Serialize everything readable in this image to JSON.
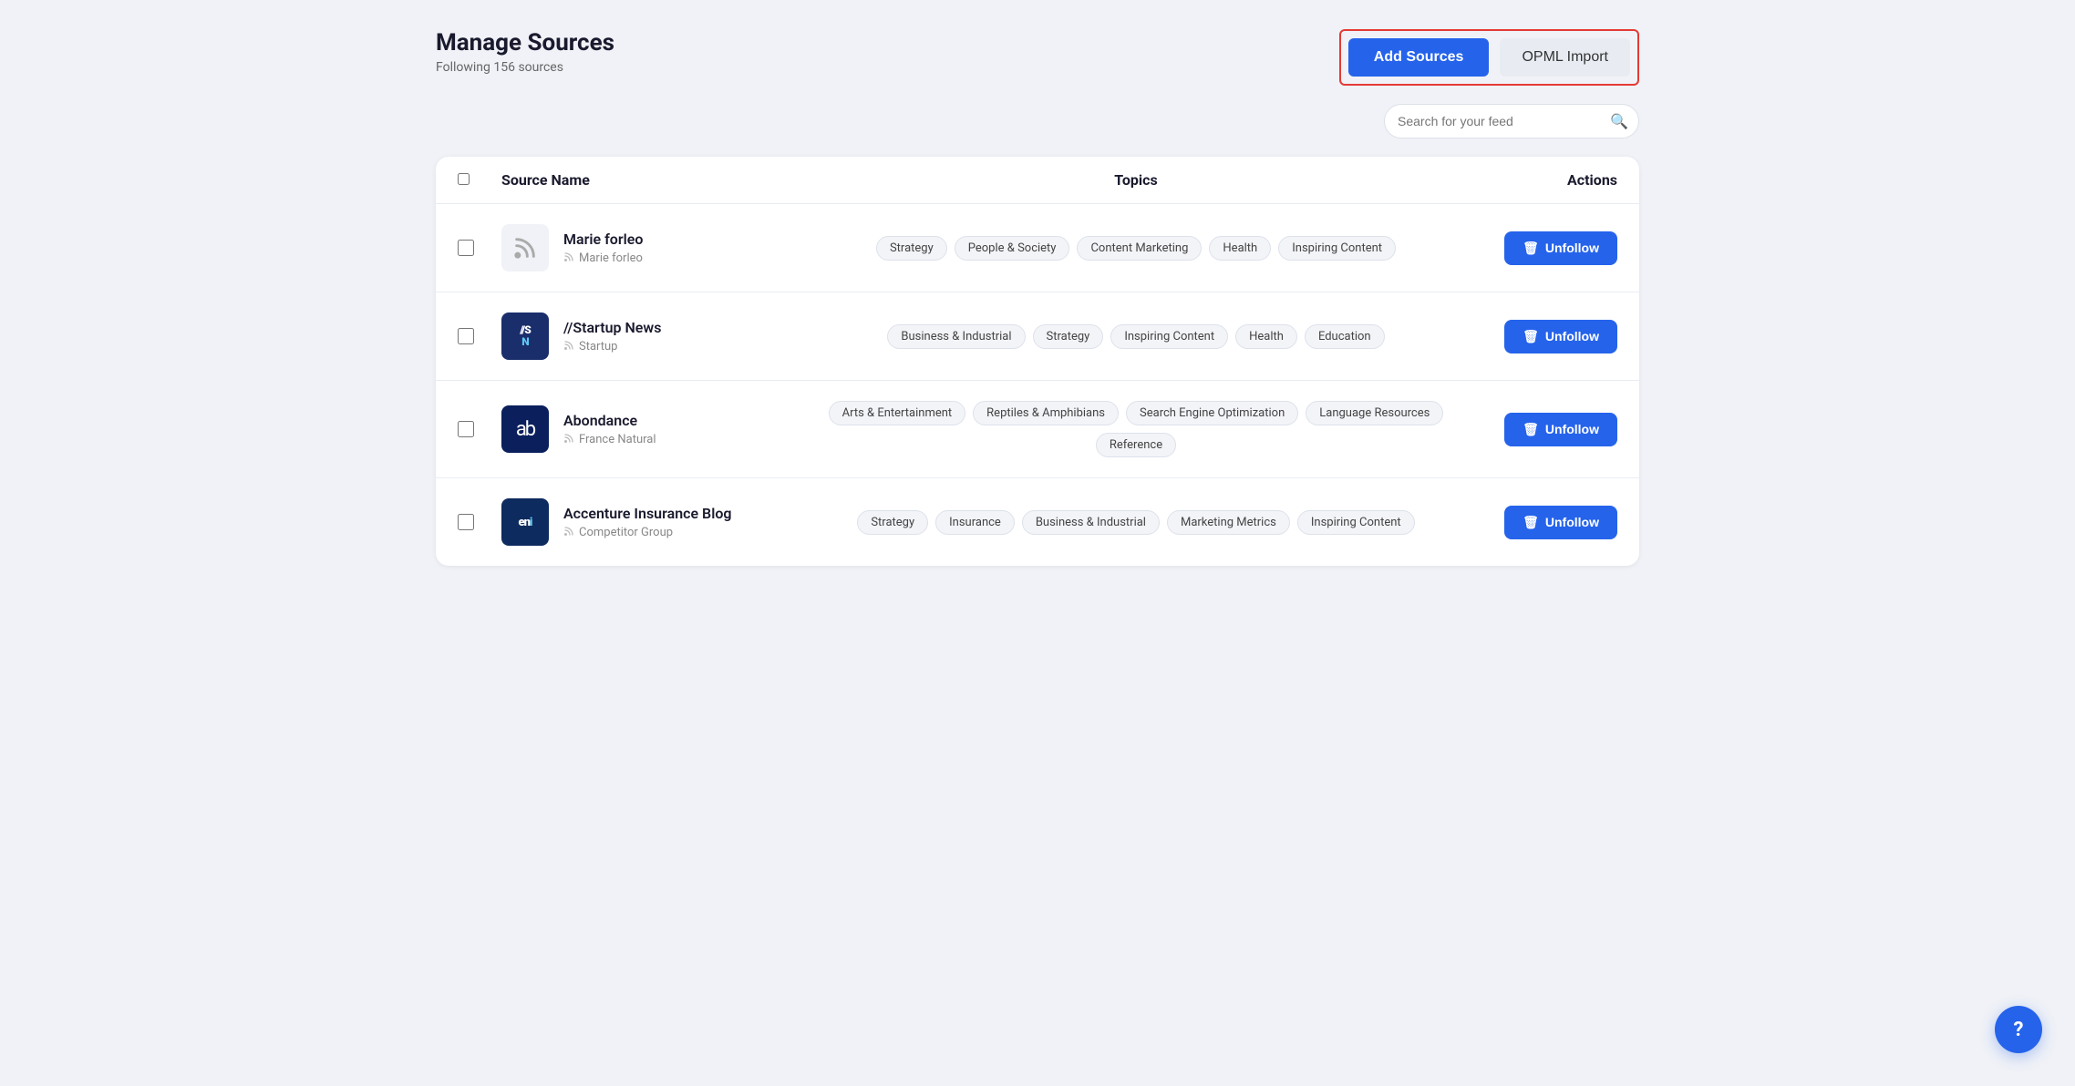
{
  "page": {
    "title": "Manage Sources",
    "subtitle": "Following 156 sources"
  },
  "header": {
    "add_sources_label": "Add Sources",
    "opml_label": "OPML Import"
  },
  "search": {
    "placeholder": "Search for your feed"
  },
  "table": {
    "col_source_name": "Source Name",
    "col_topics": "Topics",
    "col_actions": "Actions"
  },
  "sources": [
    {
      "id": "marie-forleo",
      "name": "Marie forleo",
      "sub": "Marie forleo",
      "logo_type": "rss",
      "logo_text": "",
      "topics": [
        "Strategy",
        "People & Society",
        "Content Marketing",
        "Health",
        "Inspiring Content"
      ],
      "unfollow_label": "Unfollow"
    },
    {
      "id": "startup-news",
      "name": "//Startup News",
      "sub": "Startup",
      "logo_type": "startup",
      "logo_text": "//S\nN",
      "topics": [
        "Business & Industrial",
        "Strategy",
        "Inspiring Content",
        "Health",
        "Education"
      ],
      "unfollow_label": "Unfollow"
    },
    {
      "id": "abondance",
      "name": "Abondance",
      "sub": "France Natural",
      "logo_type": "ab",
      "logo_text": "ab",
      "topics": [
        "Arts & Entertainment",
        "Reptiles & Amphibians",
        "Search Engine Optimization",
        "Language Resources",
        "Reference"
      ],
      "unfollow_label": "Unfollow"
    },
    {
      "id": "accenture-insurance",
      "name": "Accenture Insurance Blog",
      "sub": "Competitor Group",
      "logo_type": "eni",
      "logo_text": "eni",
      "topics": [
        "Strategy",
        "Insurance",
        "Business & Industrial",
        "Marketing Metrics",
        "Inspiring Content"
      ],
      "unfollow_label": "Unfollow"
    }
  ],
  "help_fab_label": "?"
}
